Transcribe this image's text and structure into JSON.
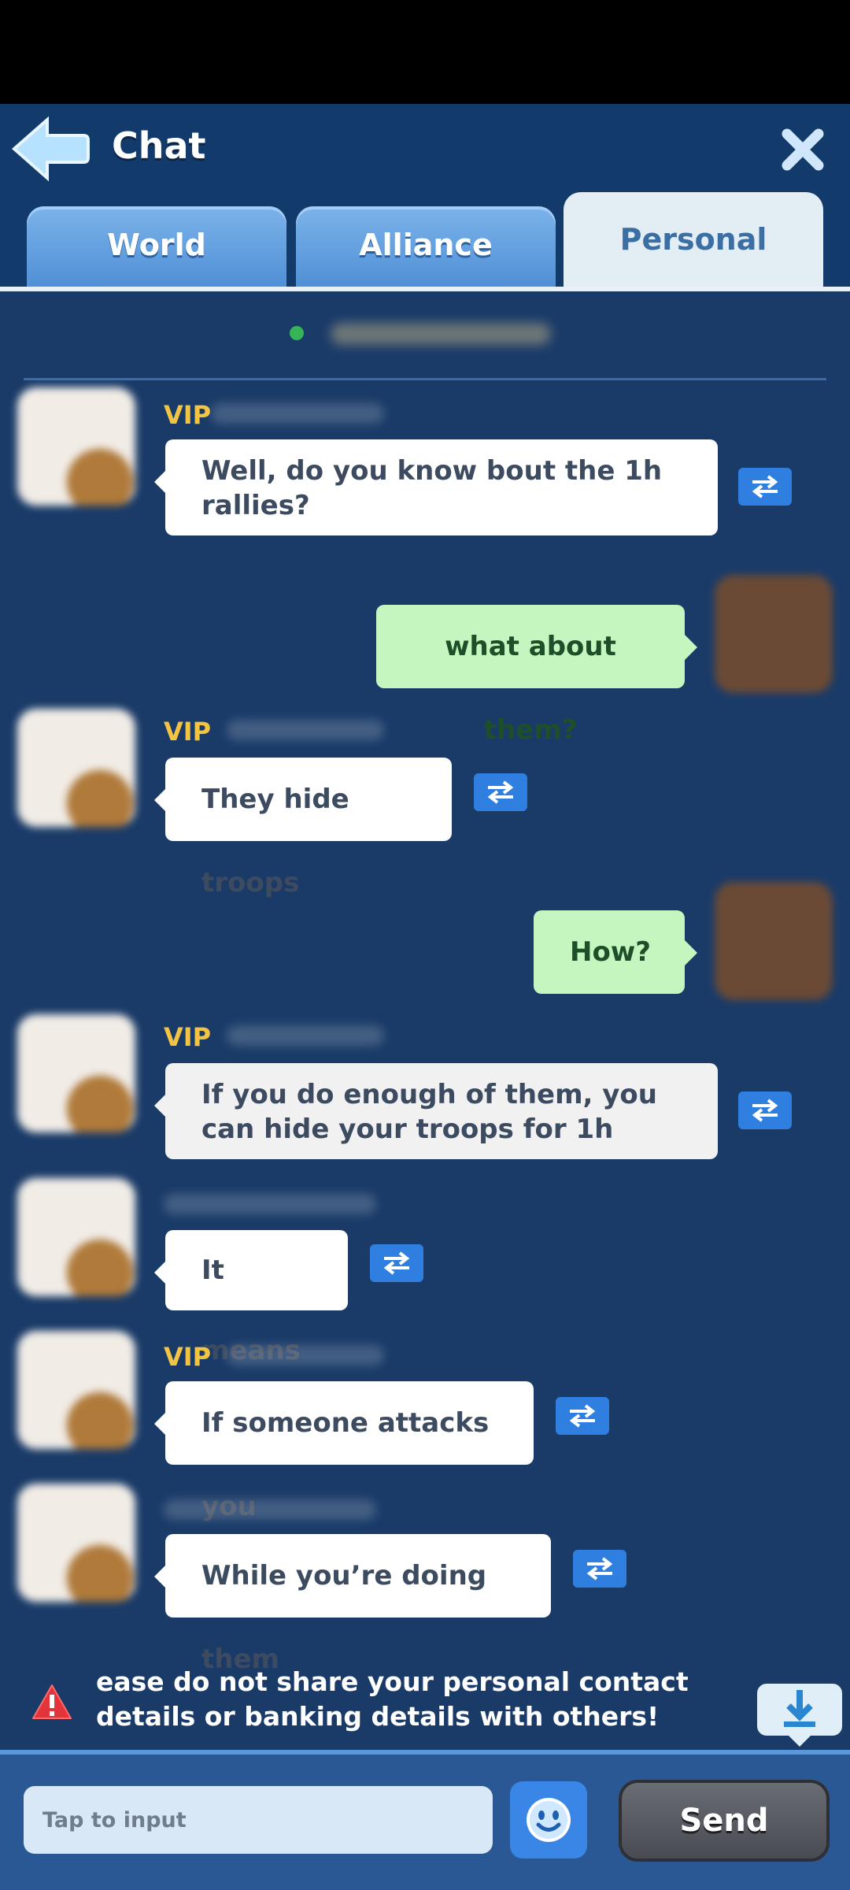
{
  "header": {
    "title": "Chat",
    "back_icon": "arrow-left-icon",
    "close_icon": "close-icon"
  },
  "tabs": [
    {
      "label": "World",
      "active": false
    },
    {
      "label": "Alliance",
      "active": false
    },
    {
      "label": "Personal",
      "active": true
    }
  ],
  "messages": [
    {
      "from": "them",
      "vip": "VIP",
      "text": "Well, do you know bout the 1h rallies?"
    },
    {
      "from": "me",
      "text": "what about them?"
    },
    {
      "from": "them",
      "vip": "VIP",
      "text": "They hide troops"
    },
    {
      "from": "me",
      "text": "How?"
    },
    {
      "from": "them",
      "vip": "VIP",
      "text": "If you do enough of them, you can hide your troops for 1h"
    },
    {
      "from": "them",
      "text": "It means"
    },
    {
      "from": "them",
      "vip": "VIP",
      "text": "If someone attacks you"
    },
    {
      "from": "them",
      "text": "While you’re doing them"
    }
  ],
  "warning": {
    "icon": "warning-icon",
    "text": "ease do not share your personal contact details or banking details with others!"
  },
  "composer": {
    "placeholder": "Tap to input",
    "send_label": "Send",
    "emoji_icon": "smiley-icon",
    "download_icon": "download-icon"
  },
  "colors": {
    "background": "#1a3b68",
    "my_bubble": "#c6f6bf",
    "translate_button": "#2f7fe0",
    "vip": "#f3c342"
  }
}
